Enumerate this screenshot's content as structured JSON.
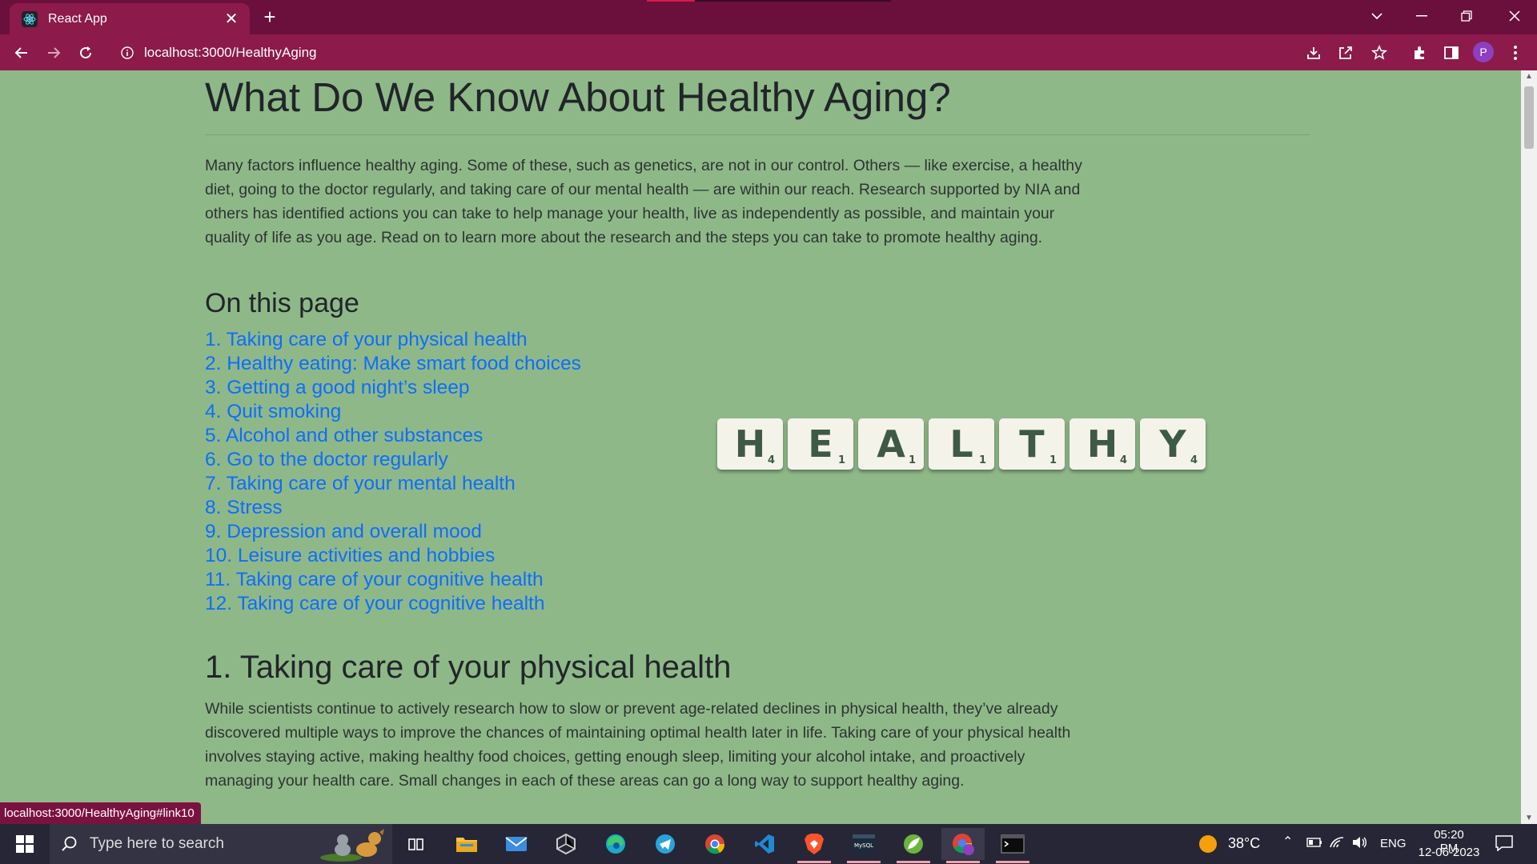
{
  "browser": {
    "tab_title": "React App",
    "url": "localhost:3000/HealthyAging",
    "profile_initial": "P",
    "status_url": "localhost:3000/HealthyAging#link10"
  },
  "page": {
    "title": "What Do We Know About Healthy Aging?",
    "intro": "Many factors influence healthy aging. Some of these, such as genetics, are not in our control. Others — like exercise, a healthy diet, going to the doctor regularly, and taking care of our mental health — are within our reach. Research supported by NIA and others has identified actions you can take to help manage your health, live as independently as possible, and maintain your quality of life as you age. Read on to learn more about the research and the steps you can take to promote healthy aging.",
    "on_this_page": "On this page",
    "toc": [
      "1. Taking care of your physical health",
      "2. Healthy eating: Make smart food choices",
      "3. Getting a good night’s sleep",
      "4. Quit smoking",
      "5. Alcohol and other substances",
      "6. Go to the doctor regularly",
      "7. Taking care of your mental health",
      "8. Stress",
      "9. Depression and overall mood",
      "10. Leisure activities and hobbies",
      "11. Taking care of your cognitive health",
      "12. Taking care of your cognitive health"
    ],
    "section1_title": "1. Taking care of your physical health",
    "section1_body": "While scientists continue to actively research how to slow or prevent age-related declines in physical health, they’ve already discovered multiple ways to improve the chances of maintaining optimal health later in life. Taking care of your physical health involves staying active, making healthy food choices, getting enough sleep, limiting your alcohol intake, and proactively managing your health care. Small changes in each of these areas can go a long way to support healthy aging.",
    "tiles": [
      {
        "letter": "H",
        "points": "4"
      },
      {
        "letter": "E",
        "points": "1"
      },
      {
        "letter": "A",
        "points": "1"
      },
      {
        "letter": "L",
        "points": "1"
      },
      {
        "letter": "T",
        "points": "1"
      },
      {
        "letter": "H",
        "points": "4"
      },
      {
        "letter": "Y",
        "points": "4"
      }
    ]
  },
  "taskbar": {
    "search_placeholder": "Type here to search",
    "temperature": "38°C",
    "language": "ENG",
    "time": "05:20 PM",
    "date": "12-06-2023"
  }
}
